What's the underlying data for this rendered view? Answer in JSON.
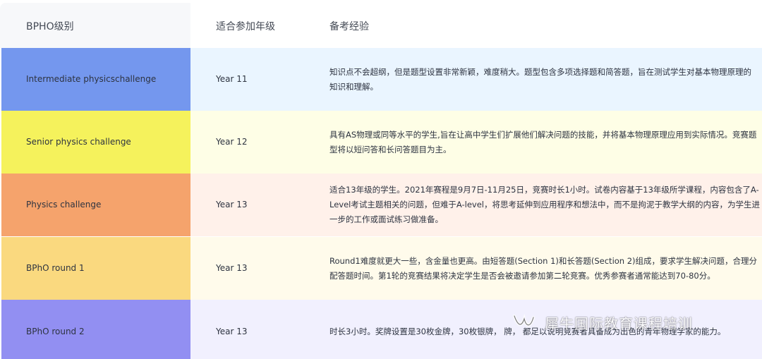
{
  "header": {
    "col_level": "BPHO级别",
    "col_grade": "适合参加年级",
    "col_experience": "备考经验"
  },
  "rows": [
    {
      "level": "Intermediate physicschallenge",
      "grade": "Year 11",
      "experience": "知识点不会超纲，但是题型设置非常新颖，难度稍大。题型包含多项选择题和简答题，旨在测试学生对基本物理原理的知识和理解。",
      "level_color": "#7497ee",
      "rest_color": "#eaf5ff"
    },
    {
      "level": "Senior physics challenge",
      "grade": "Year 12",
      "experience": "具有AS物理或同等水平的学生,旨在让高中学生们扩展他们解决问题的技能，并将基本物理原理应用到实际情况。竞赛题型将以短问答和长问答题目为主。",
      "level_color": "#f5f25c",
      "rest_color": "#fefee6"
    },
    {
      "level": "Physics challenge",
      "grade": "Year 13",
      "experience": "适合13年级的学生。2021年赛程是9月7日-11月25日，竞赛时长1小时。试卷内容基于13年级所学课程，内容包含了A-Level考试主题相关的问题，但难于A-level，将思考延伸到应用程序和想法中，而不是拘泥于教学大纲的内容，为学生进一步的工作或面试练习做准备。",
      "level_color": "#f5a36c",
      "rest_color": "#fff1ea"
    },
    {
      "level": "BPhO round 1",
      "grade": "Year 13",
      "experience": "Round1难度就更大一些，含金量也更高。由短答题(Section 1)和长答题(Section 2)组成，要求学生解决问题，合理分配答题时间。第1轮的竞赛结果将决定学生是否会被邀请参加第二轮竞赛。优秀参赛者通常能达到70-80分。",
      "level_color": "#fad97f",
      "rest_color": "#fffbeb"
    },
    {
      "level": "BPhO round 2",
      "grade": "Year 13",
      "experience": "时长3小时。奖牌设置是30枚金牌，30枚银牌，      牌，                                      都足以说明竞赛者具备成为出色的青年物理学家的能力。",
      "level_color": "#928ff2",
      "rest_color": "#f1f0fe"
    }
  ],
  "watermark": {
    "text": "犀牛国际教育课程培训",
    "icon": "wechat-channel-icon"
  }
}
